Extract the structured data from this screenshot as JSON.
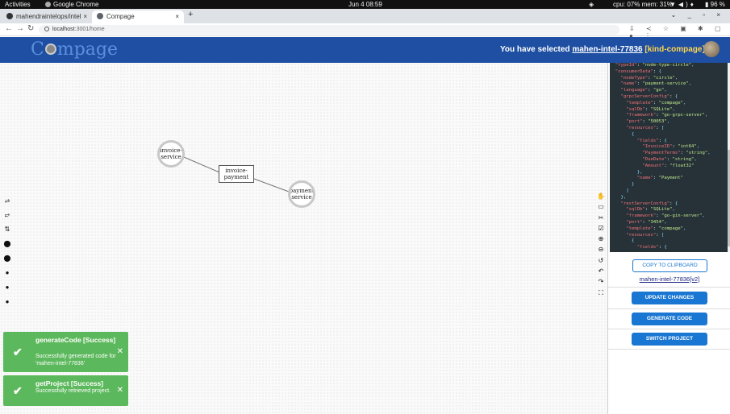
{
  "system_bar": {
    "activities": "Activities",
    "app": "Google Chrome",
    "clock": "Jun 4  08:59",
    "stats": "cpu: 07% mem: 31%",
    "battery": "96 %"
  },
  "browser": {
    "tabs": [
      {
        "label": "mahendraintelops/intel",
        "active": false
      },
      {
        "label": "Compage",
        "active": true
      }
    ],
    "url_host": "localhost",
    "url_path": ":3001/home"
  },
  "header": {
    "logo_pre": "C",
    "logo_post": "mpage",
    "selected_prefix": "You have selected",
    "project": "mahen-intel-77836",
    "context": "[kind-compage]"
  },
  "canvas": {
    "nodes": [
      {
        "id": "invoice-service",
        "label_line1": "invoice-",
        "label_line2": "service",
        "shape": "circle"
      },
      {
        "id": "invoice-payment",
        "label_line1": "invoice-",
        "label_line2": "payment",
        "shape": "rect"
      },
      {
        "id": "payment-service",
        "label_line1": "payment",
        "label_line2": "service",
        "shape": "circle"
      }
    ]
  },
  "toasts": [
    {
      "title": "generateCode [Success]",
      "message": "Successfully generated code for 'mahen-intel-77836'"
    },
    {
      "title": "getProject [Success]",
      "message": "Successfully retrieved project."
    }
  ],
  "panel": {
    "code_lines": [
      "  \"typeId\": \"node-type-circle\",",
      "  \"consumerData\": {",
      "    \"nodeType\": \"circle\",",
      "    \"name\": \"payment-service\",",
      "    \"language\": \"go\",",
      "    \"grpcServerConfig\": {",
      "      \"template\": \"compage\",",
      "      \"sqlDb\": \"SQLite\",",
      "      \"framework\": \"go-grpc-server\",",
      "      \"port\": \"50053\",",
      "      \"resources\": [",
      "        {",
      "          \"fields\": {",
      "            \"InvoiceID\": \"int64\",",
      "            \"PaymentTerms\": \"string\",",
      "            \"DueDate\": \"string\",",
      "            \"Amount\": \"float32\"",
      "          },",
      "          \"name\": \"Payment\"",
      "        }",
      "      ]",
      "    },",
      "    \"restServerConfig\": {",
      "      \"sqlDb\": \"SQLite\",",
      "      \"framework\": \"go-gin-server\",",
      "      \"port\": \"3454\",",
      "      \"template\": \"compage\",",
      "      \"resources\": [",
      "        {",
      "          \"fields\": {"
    ],
    "copy_label": "COPY TO CLIPBOARD",
    "project_link": "mahen-intel-77836[v2]",
    "update_label": "UPDATE CHANGES",
    "generate_label": "GENERATE CODE",
    "switch_label": "SWITCH PROJECT"
  },
  "colors": {
    "appbar": "#1e4fa2",
    "toast": "#5cb85c",
    "primary": "#1976d2"
  }
}
